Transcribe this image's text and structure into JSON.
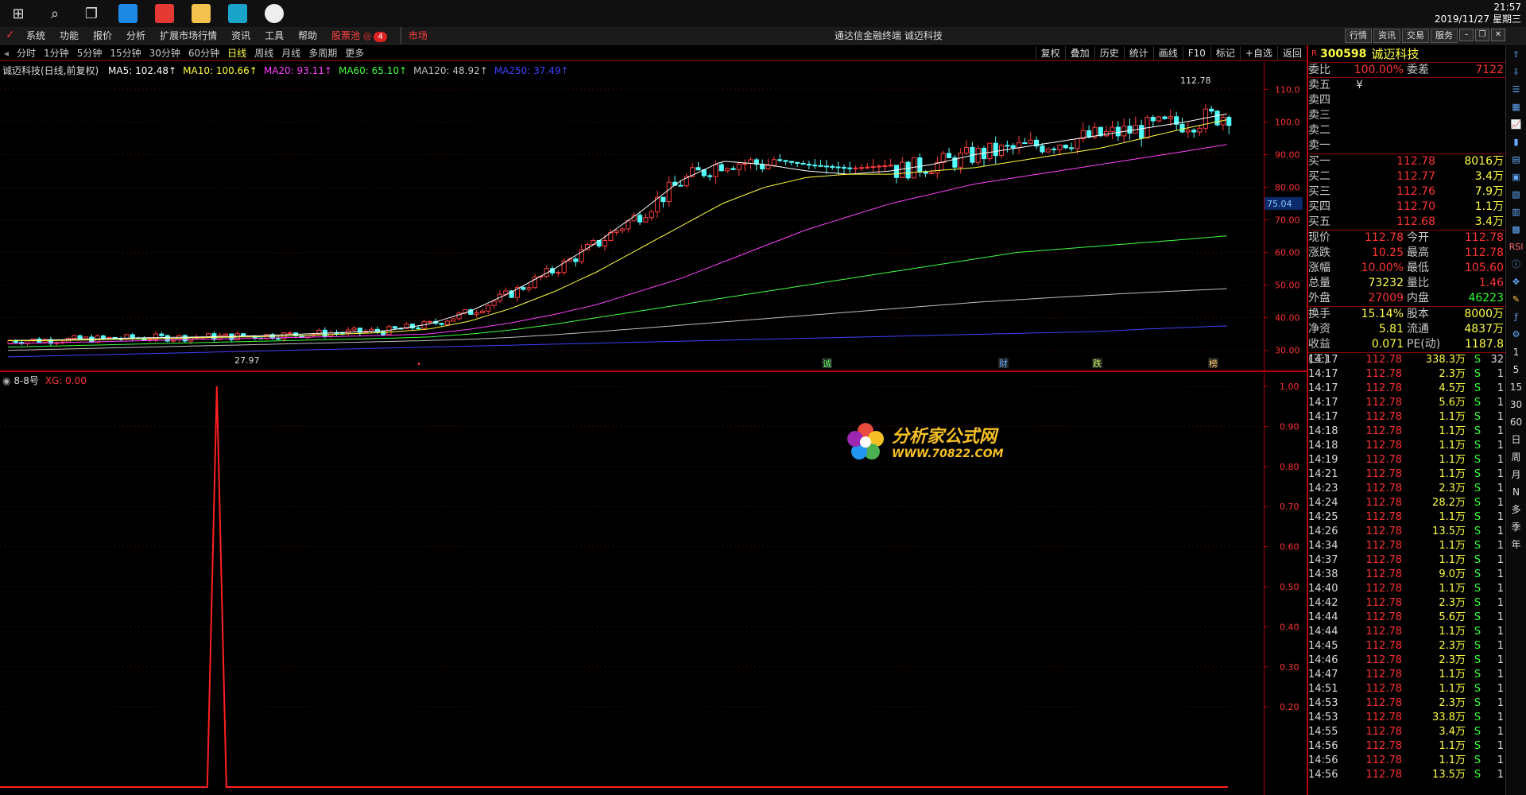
{
  "taskbar": {
    "time": "21:57",
    "date": "2019/11/27 星期三"
  },
  "menubar": {
    "items": [
      "系统",
      "功能",
      "报价",
      "分析",
      "扩展市场行情",
      "资讯",
      "工具",
      "帮助"
    ],
    "stock_pool": "股票池",
    "stock_pool_badge": "4",
    "market": "市场",
    "title": "通达信金融终端  诚迈科技",
    "right_buttons": [
      "行情",
      "资讯",
      "交易",
      "服务"
    ]
  },
  "periodbar": {
    "items": [
      "分时",
      "1分钟",
      "5分钟",
      "15分钟",
      "30分钟",
      "60分钟",
      "日线",
      "周线",
      "月线",
      "多周期",
      "更多"
    ],
    "active": "日线",
    "tools": [
      "复权",
      "叠加",
      "历史",
      "统计",
      "画线",
      "F10",
      "标记",
      "+自选",
      "返回"
    ]
  },
  "ma_legend": {
    "title": "诚迈科技(日线,前复权)",
    "items": [
      {
        "label": "MA5: 102.48",
        "color": "#ffffff"
      },
      {
        "label": "MA10: 100.66",
        "color": "#ffff40"
      },
      {
        "label": "MA20: 93.11",
        "color": "#ff40ff"
      },
      {
        "label": "MA60: 65.10",
        "color": "#40ff40"
      },
      {
        "label": "MA120: 48.92",
        "color": "#c0c0c0"
      },
      {
        "label": "MA250: 37.49",
        "color": "#4040ff"
      }
    ]
  },
  "price_axis": [
    "110.0",
    "100.0",
    "90.00",
    "80.00",
    "70.00",
    "60.00",
    "50.00",
    "40.00",
    "30.00"
  ],
  "price_marker": "75.04",
  "high_label": "112.78",
  "low_label": "27.97",
  "event_labels": [
    "诚",
    "财",
    "跌",
    "榜"
  ],
  "indicator": {
    "legend_name": "8-8号",
    "legend_value": "XG: 0.00",
    "axis": [
      "1.00",
      "0.90",
      "0.80",
      "0.70",
      "0.60",
      "0.50",
      "0.40",
      "0.30",
      "0.20"
    ]
  },
  "watermark": {
    "cn": "分析家公式网",
    "url": "WWW.70822.COM"
  },
  "stock": {
    "code": "300598",
    "name": "诚迈科技",
    "wei_bi_label": "委比",
    "wei_bi": "100.00%",
    "wei_cha_label": "委差",
    "wei_cha": "7122",
    "sell": [
      {
        "label": "卖五",
        "price": "¥",
        "vol": ""
      },
      {
        "label": "卖四",
        "price": "",
        "vol": ""
      },
      {
        "label": "卖三",
        "price": "",
        "vol": ""
      },
      {
        "label": "卖二",
        "price": "",
        "vol": ""
      },
      {
        "label": "卖一",
        "price": "",
        "vol": ""
      }
    ],
    "buy": [
      {
        "label": "买一",
        "price": "112.78",
        "vol": "8016万"
      },
      {
        "label": "买二",
        "price": "112.77",
        "vol": "3.4万"
      },
      {
        "label": "买三",
        "price": "112.76",
        "vol": "7.9万"
      },
      {
        "label": "买四",
        "price": "112.70",
        "vol": "1.1万"
      },
      {
        "label": "买五",
        "price": "112.68",
        "vol": "3.4万"
      }
    ],
    "quote": [
      {
        "l1": "现价",
        "v1": "112.78",
        "c1": "red",
        "l2": "今开",
        "v2": "112.78",
        "c2": "red"
      },
      {
        "l1": "涨跌",
        "v1": "10.25",
        "c1": "red",
        "l2": "最高",
        "v2": "112.78",
        "c2": "red"
      },
      {
        "l1": "涨幅",
        "v1": "10.00%",
        "c1": "red",
        "l2": "最低",
        "v2": "105.60",
        "c2": "red"
      },
      {
        "l1": "总量",
        "v1": "73232",
        "c1": "yellow",
        "l2": "量比",
        "v2": "1.46",
        "c2": "red"
      },
      {
        "l1": "外盘",
        "v1": "27009",
        "c1": "red",
        "l2": "内盘",
        "v2": "46223",
        "c2": "green"
      }
    ],
    "info": [
      {
        "l1": "换手",
        "v1": "15.14%",
        "l2": "股本",
        "v2": "8000万"
      },
      {
        "l1": "净资",
        "v1": "5.81",
        "l2": "流通",
        "v2": "4837万"
      },
      {
        "l1": "收益(三)",
        "v1": "0.071",
        "l2": "PE(动)",
        "v2": "1187.8"
      }
    ],
    "ticks": [
      {
        "t": "14:17",
        "p": "112.78",
        "v": "338.3万",
        "s": "S",
        "n": "32"
      },
      {
        "t": "14:17",
        "p": "112.78",
        "v": "2.3万",
        "s": "S",
        "n": "1"
      },
      {
        "t": "14:17",
        "p": "112.78",
        "v": "4.5万",
        "s": "S",
        "n": "1"
      },
      {
        "t": "14:17",
        "p": "112.78",
        "v": "5.6万",
        "s": "S",
        "n": "1"
      },
      {
        "t": "14:17",
        "p": "112.78",
        "v": "1.1万",
        "s": "S",
        "n": "1"
      },
      {
        "t": "14:18",
        "p": "112.78",
        "v": "1.1万",
        "s": "S",
        "n": "1"
      },
      {
        "t": "14:18",
        "p": "112.78",
        "v": "1.1万",
        "s": "S",
        "n": "1"
      },
      {
        "t": "14:19",
        "p": "112.78",
        "v": "1.1万",
        "s": "S",
        "n": "1"
      },
      {
        "t": "14:21",
        "p": "112.78",
        "v": "1.1万",
        "s": "S",
        "n": "1"
      },
      {
        "t": "14:23",
        "p": "112.78",
        "v": "2.3万",
        "s": "S",
        "n": "1"
      },
      {
        "t": "14:24",
        "p": "112.78",
        "v": "28.2万",
        "s": "S",
        "n": "1"
      },
      {
        "t": "14:25",
        "p": "112.78",
        "v": "1.1万",
        "s": "S",
        "n": "1"
      },
      {
        "t": "14:26",
        "p": "112.78",
        "v": "13.5万",
        "s": "S",
        "n": "1"
      },
      {
        "t": "14:34",
        "p": "112.78",
        "v": "1.1万",
        "s": "S",
        "n": "1"
      },
      {
        "t": "14:37",
        "p": "112.78",
        "v": "1.1万",
        "s": "S",
        "n": "1"
      },
      {
        "t": "14:38",
        "p": "112.78",
        "v": "9.0万",
        "s": "S",
        "n": "1"
      },
      {
        "t": "14:40",
        "p": "112.78",
        "v": "1.1万",
        "s": "S",
        "n": "1"
      },
      {
        "t": "14:42",
        "p": "112.78",
        "v": "2.3万",
        "s": "S",
        "n": "1"
      },
      {
        "t": "14:44",
        "p": "112.78",
        "v": "5.6万",
        "s": "S",
        "n": "1"
      },
      {
        "t": "14:44",
        "p": "112.78",
        "v": "1.1万",
        "s": "S",
        "n": "1"
      },
      {
        "t": "14:45",
        "p": "112.78",
        "v": "2.3万",
        "s": "S",
        "n": "1"
      },
      {
        "t": "14:46",
        "p": "112.78",
        "v": "2.3万",
        "s": "S",
        "n": "1"
      },
      {
        "t": "14:47",
        "p": "112.78",
        "v": "1.1万",
        "s": "S",
        "n": "1"
      },
      {
        "t": "14:51",
        "p": "112.78",
        "v": "1.1万",
        "s": "S",
        "n": "1"
      },
      {
        "t": "14:53",
        "p": "112.78",
        "v": "2.3万",
        "s": "S",
        "n": "1"
      },
      {
        "t": "14:53",
        "p": "112.78",
        "v": "33.8万",
        "s": "S",
        "n": "1"
      },
      {
        "t": "14:55",
        "p": "112.78",
        "v": "3.4万",
        "s": "S",
        "n": "1"
      },
      {
        "t": "14:56",
        "p": "112.78",
        "v": "1.1万",
        "s": "S",
        "n": "1"
      },
      {
        "t": "14:56",
        "p": "112.78",
        "v": "1.1万",
        "s": "S",
        "n": "1"
      },
      {
        "t": "14:56",
        "p": "112.78",
        "v": "13.5万",
        "s": "S",
        "n": "1"
      }
    ]
  },
  "iconbar": {
    "text_items": [
      "1",
      "5",
      "15",
      "30",
      "60",
      "日",
      "周",
      "月",
      "N",
      "多",
      "季",
      "年"
    ]
  },
  "chart_data": {
    "type": "candlestick",
    "ylim": [
      27,
      114
    ],
    "ma_lines": [
      {
        "name": "MA5",
        "color": "#ffffff",
        "values": [
          33,
          33.2,
          33.5,
          33.8,
          34,
          34.2,
          34.5,
          35,
          35.5,
          36,
          38,
          42,
          48,
          55,
          63,
          72,
          82,
          88,
          87,
          85,
          84,
          85,
          87,
          90,
          92,
          94,
          96,
          98,
          100,
          102.5
        ]
      },
      {
        "name": "MA10",
        "color": "#ffff40",
        "values": [
          33,
          33,
          33.2,
          33.5,
          33.7,
          34,
          34.2,
          34.5,
          35,
          35.5,
          36.5,
          39,
          43,
          48,
          54,
          61,
          68,
          75,
          80,
          83,
          84,
          84,
          85,
          86,
          88,
          90,
          92,
          95,
          98,
          100.7
        ]
      },
      {
        "name": "MA20",
        "color": "#ff40ff",
        "values": [
          32,
          32.3,
          32.6,
          32.9,
          33.2,
          33.5,
          33.7,
          34,
          34.3,
          34.6,
          35,
          36.5,
          38.5,
          41,
          44,
          48,
          52,
          57,
          62,
          67,
          71,
          75,
          78,
          81,
          83,
          85,
          87,
          89,
          91,
          93.1
        ]
      },
      {
        "name": "MA60",
        "color": "#40ff40",
        "values": [
          31,
          31.3,
          31.6,
          31.9,
          32.2,
          32.5,
          32.8,
          33.1,
          33.4,
          33.7,
          34.1,
          35,
          36.3,
          38,
          40,
          42,
          44,
          46,
          48,
          50,
          52,
          54,
          56,
          58,
          60,
          61,
          62,
          63,
          64,
          65.1
        ]
      },
      {
        "name": "MA120",
        "color": "#c0c0c0",
        "values": [
          30,
          30.3,
          30.6,
          30.9,
          31.2,
          31.5,
          31.8,
          32.1,
          32.4,
          32.7,
          33,
          33.4,
          34,
          34.8,
          35.7,
          36.7,
          37.7,
          38.7,
          39.7,
          40.7,
          41.7,
          42.7,
          43.7,
          44.7,
          45.5,
          46.3,
          47,
          47.7,
          48.3,
          48.9
        ]
      },
      {
        "name": "MA250",
        "color": "#4040ff",
        "values": [
          28,
          28.3,
          28.6,
          28.9,
          29.2,
          29.5,
          29.8,
          30.1,
          30.4,
          30.7,
          31,
          31.3,
          31.6,
          31.9,
          32.2,
          32.5,
          32.8,
          33.1,
          33.4,
          33.7,
          34,
          34.3,
          34.6,
          34.9,
          35.2,
          35.5,
          35.8,
          36.5,
          37,
          37.5
        ]
      }
    ],
    "indicator": {
      "name": "XG",
      "ylim": [
        0,
        1
      ],
      "spike_at": 0.17,
      "spike_value": 1.0,
      "baseline": 0
    }
  }
}
